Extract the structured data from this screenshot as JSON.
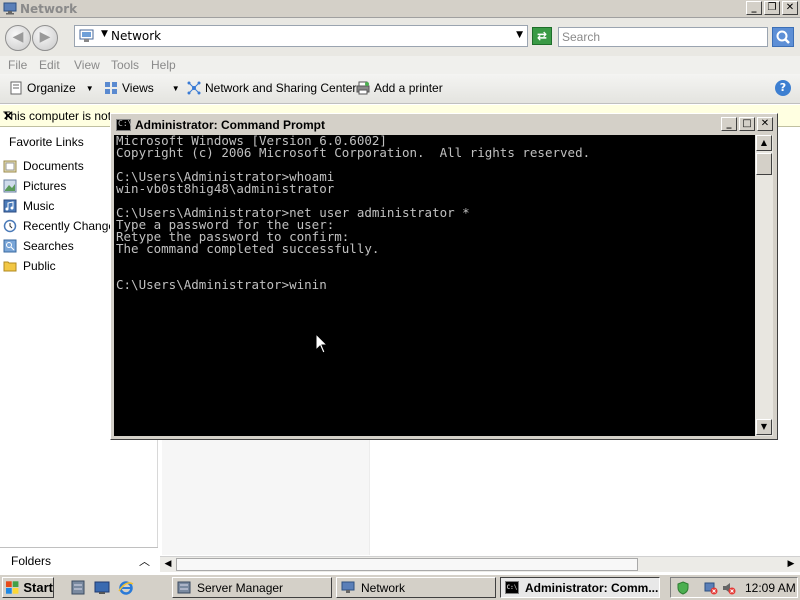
{
  "explorer": {
    "title": "Network",
    "address": "Network",
    "search_placeholder": "Search",
    "menu": [
      "File",
      "Edit",
      "View",
      "Tools",
      "Help"
    ],
    "toolbar": {
      "organize": "Organize",
      "views": "Views",
      "network_center": "Network and Sharing Center",
      "add_printer": "Add a printer"
    },
    "infobar": "This computer is not cc",
    "favorite_links_title": "Favorite Links",
    "favorites": [
      "Documents",
      "Pictures",
      "Music",
      "Recently Changed",
      "Searches",
      "Public"
    ],
    "folders_label": "Folders"
  },
  "cmd": {
    "title": "Administrator: Command Prompt",
    "console_text": "Microsoft Windows [Version 6.0.6002]\nCopyright (c) 2006 Microsoft Corporation.  All rights reserved.\n\nC:\\Users\\Administrator>whoami\nwin-vb0st8hig48\\administrator\n\nC:\\Users\\Administrator>net user administrator *\nType a password for the user:\nRetype the password to confirm:\nThe command completed successfully.\n\n\nC:\\Users\\Administrator>winin"
  },
  "taskbar": {
    "start": "Start",
    "tasks": [
      "Server Manager",
      "Network",
      "Administrator: Comm..."
    ],
    "clock": "12:09 AM"
  },
  "colors": {
    "console_bg": "#000000",
    "console_fg": "#c0c0c0",
    "window_chrome": "#d4d0c8",
    "infobar_bg": "#ffffe1"
  },
  "icons": {
    "explorer_app": "network-icon",
    "cmd_app": "cmd-icon",
    "search": "search-icon",
    "help": "help-icon"
  }
}
